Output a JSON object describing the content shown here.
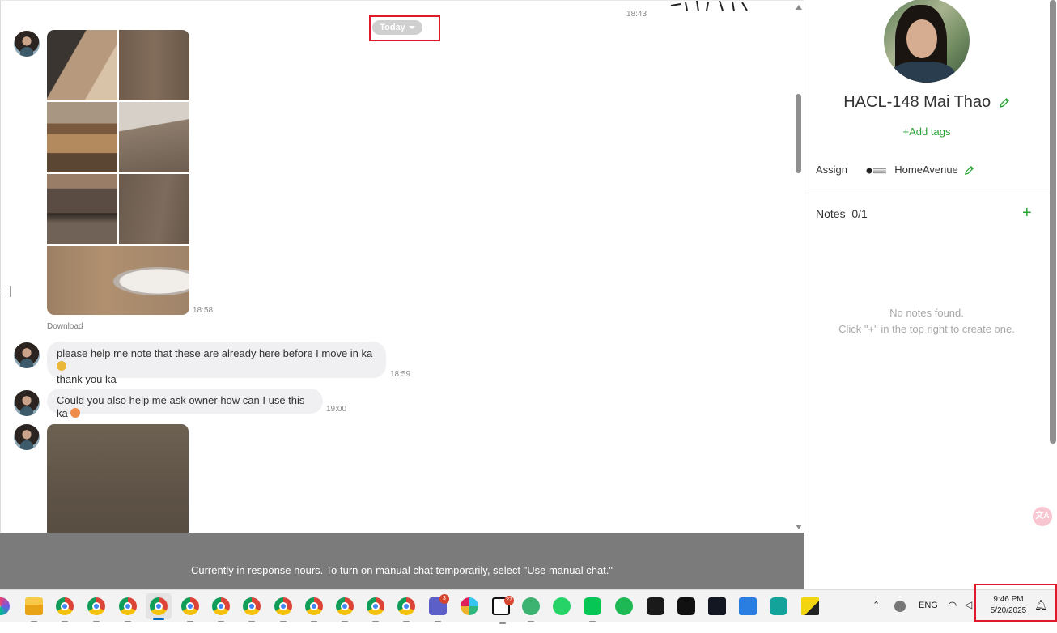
{
  "chat": {
    "date_filter": "Today",
    "first_time": "18:43",
    "messages": [
      {
        "time": "18:58",
        "download_label": "Download"
      },
      {
        "line1": "please help me note that these are already here before I move in ka",
        "line2": "thank you ka",
        "time": "18:59"
      },
      {
        "text": "Could you also help me ask owner how can I use this ka",
        "time": "19:00"
      },
      {
        "type": "image"
      }
    ],
    "banner_text": "Currently in response hours. To turn on manual chat temporarily, select \"Use manual chat.\""
  },
  "profile": {
    "name": "HACL-148 Mai Thao",
    "add_tags_label": "Add tags",
    "assign_label": "Assign",
    "assignee": "HomeAvenue",
    "notes_label": "Notes",
    "notes_count": "0/1",
    "no_notes_line1": "No notes found.",
    "no_notes_line2": "Click \"+\" in the top right to create one.",
    "translate_label": "文A"
  },
  "taskbar": {
    "badges": {
      "teams": "3",
      "notion": "27"
    },
    "language": "ENG",
    "time": "9:46 PM",
    "date": "5/20/2025"
  },
  "colors": {
    "accent_green": "#27a235",
    "highlight_red": "#e0192a",
    "banner_gray": "#7b7b7b"
  }
}
